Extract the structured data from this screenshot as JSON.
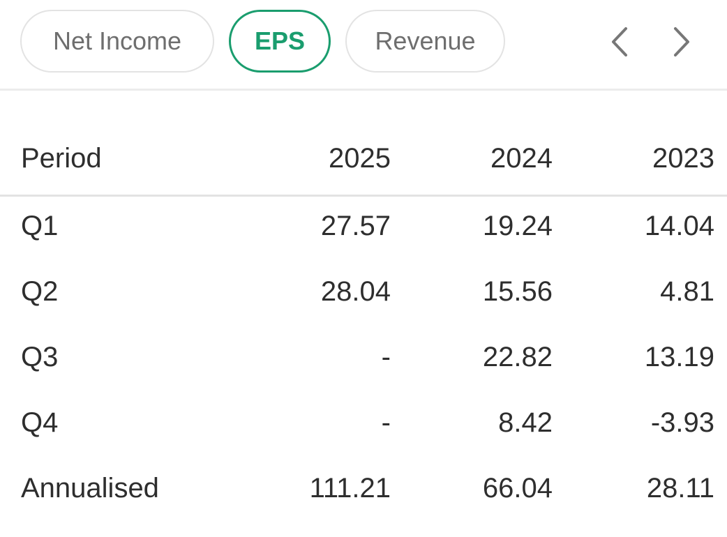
{
  "tabs": [
    {
      "label": "Net Income",
      "active": false
    },
    {
      "label": "EPS",
      "active": true
    },
    {
      "label": "Revenue",
      "active": false
    }
  ],
  "nav": {
    "prev_icon": "chevron-left-icon",
    "next_icon": "chevron-right-icon"
  },
  "colors": {
    "accent": "#1a9d6e",
    "text": "#2e2e2e",
    "muted": "#6e6e6e",
    "border": "#e3e3e3"
  },
  "table": {
    "headers": [
      "Period",
      "2025",
      "2024",
      "2023"
    ],
    "rows": [
      {
        "label": "Q1",
        "values": [
          "27.57",
          "19.24",
          "14.04"
        ]
      },
      {
        "label": "Q2",
        "values": [
          "28.04",
          "15.56",
          "4.81"
        ]
      },
      {
        "label": "Q3",
        "values": [
          "-",
          "22.82",
          "13.19"
        ]
      },
      {
        "label": "Q4",
        "values": [
          "-",
          "8.42",
          "-3.93"
        ]
      },
      {
        "label": "Annualised",
        "values": [
          "111.21",
          "66.04",
          "28.11"
        ]
      }
    ]
  }
}
